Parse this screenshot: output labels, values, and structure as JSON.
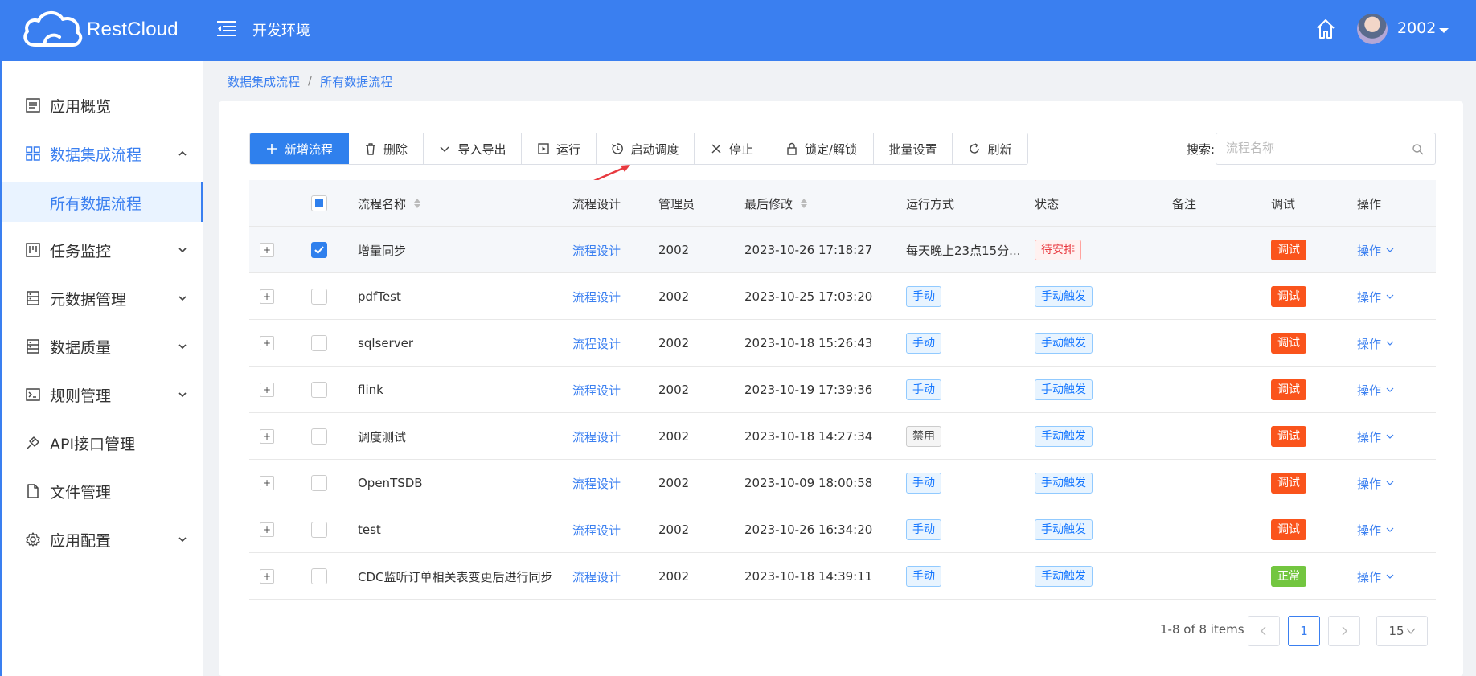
{
  "header": {
    "logo_text": "RestCloud",
    "env_title": "开发环境",
    "user_name": "2002"
  },
  "sidebar": {
    "items": [
      {
        "label": "应用概览",
        "icon": "overview-icon",
        "has_children": false
      },
      {
        "label": "数据集成流程",
        "icon": "grid-icon",
        "has_children": true,
        "expanded": true
      },
      {
        "label": "任务监控",
        "icon": "monitor-icon",
        "has_children": true
      },
      {
        "label": "元数据管理",
        "icon": "metadata-icon",
        "has_children": true
      },
      {
        "label": "数据质量",
        "icon": "quality-icon",
        "has_children": true
      },
      {
        "label": "规则管理",
        "icon": "terminal-icon",
        "has_children": true
      },
      {
        "label": "API接口管理",
        "icon": "api-icon",
        "has_children": false
      },
      {
        "label": "文件管理",
        "icon": "file-icon",
        "has_children": false
      },
      {
        "label": "应用配置",
        "icon": "gear-icon",
        "has_children": true
      }
    ],
    "sub_item": "所有数据流程"
  },
  "breadcrumb": {
    "parent": "数据集成流程",
    "separator": "/",
    "current": "所有数据流程"
  },
  "toolbar": {
    "buttons": [
      {
        "label": "新增流程",
        "icon": "plus-icon"
      },
      {
        "label": "删除",
        "icon": "trash-icon"
      },
      {
        "label": "导入导出",
        "icon": "chevron-down-icon"
      },
      {
        "label": "运行",
        "icon": "play-icon"
      },
      {
        "label": "启动调度",
        "icon": "schedule-icon"
      },
      {
        "label": "停止",
        "icon": "close-icon"
      },
      {
        "label": "锁定/解锁",
        "icon": "lock-icon"
      },
      {
        "label": "批量设置",
        "icon": ""
      },
      {
        "label": "刷新",
        "icon": "refresh-icon"
      }
    ]
  },
  "search": {
    "label": "搜索:",
    "placeholder": "流程名称",
    "value": ""
  },
  "table": {
    "columns": [
      "流程名称",
      "流程设计",
      "管理员",
      "最后修改",
      "运行方式",
      "状态",
      "备注",
      "调试",
      "操作"
    ],
    "rows": [
      {
        "name": "增量同步",
        "design": "流程设计",
        "admin": "2002",
        "modified": "2023-10-26 17:18:27",
        "run_mode": "每天晚上23点15分...",
        "run_mode_tag": "none",
        "status": "待安排",
        "status_tag": "red",
        "note": "",
        "debug": "调试",
        "debug_color": "orange",
        "op": "操作",
        "checked": true
      },
      {
        "name": "pdfTest",
        "design": "流程设计",
        "admin": "2002",
        "modified": "2023-10-25 17:03:20",
        "run_mode": "手动",
        "run_mode_tag": "blue",
        "status": "手动触发",
        "status_tag": "blue",
        "note": "",
        "debug": "调试",
        "debug_color": "orange",
        "op": "操作",
        "checked": false
      },
      {
        "name": "sqlserver",
        "design": "流程设计",
        "admin": "2002",
        "modified": "2023-10-18 15:26:43",
        "run_mode": "手动",
        "run_mode_tag": "blue",
        "status": "手动触发",
        "status_tag": "blue",
        "note": "",
        "debug": "调试",
        "debug_color": "orange",
        "op": "操作",
        "checked": false
      },
      {
        "name": "flink",
        "design": "流程设计",
        "admin": "2002",
        "modified": "2023-10-19 17:39:36",
        "run_mode": "手动",
        "run_mode_tag": "blue",
        "status": "手动触发",
        "status_tag": "blue",
        "note": "",
        "debug": "调试",
        "debug_color": "orange",
        "op": "操作",
        "checked": false
      },
      {
        "name": "调度测试",
        "design": "流程设计",
        "admin": "2002",
        "modified": "2023-10-18 14:27:34",
        "run_mode": "禁用",
        "run_mode_tag": "gray",
        "status": "手动触发",
        "status_tag": "blue",
        "note": "",
        "debug": "调试",
        "debug_color": "orange",
        "op": "操作",
        "checked": false
      },
      {
        "name": "OpenTSDB",
        "design": "流程设计",
        "admin": "2002",
        "modified": "2023-10-09 18:00:58",
        "run_mode": "手动",
        "run_mode_tag": "blue",
        "status": "手动触发",
        "status_tag": "blue",
        "note": "",
        "debug": "调试",
        "debug_color": "orange",
        "op": "操作",
        "checked": false
      },
      {
        "name": "test",
        "design": "流程设计",
        "admin": "2002",
        "modified": "2023-10-26 16:34:20",
        "run_mode": "手动",
        "run_mode_tag": "blue",
        "status": "手动触发",
        "status_tag": "blue",
        "note": "",
        "debug": "调试",
        "debug_color": "orange",
        "op": "操作",
        "checked": false
      },
      {
        "name": "CDC监听订单相关表变更后进行同步",
        "design": "流程设计",
        "admin": "2002",
        "modified": "2023-10-18 14:39:11",
        "run_mode": "手动",
        "run_mode_tag": "blue",
        "status": "手动触发",
        "status_tag": "blue",
        "note": "",
        "debug": "正常",
        "debug_color": "green",
        "op": "操作",
        "checked": false
      }
    ]
  },
  "pagination": {
    "info": "1-8 of 8 items",
    "current_page": "1",
    "page_size": "15"
  },
  "colors": {
    "primary": "#3a7ff0",
    "debug_orange": "#fa541c",
    "ok_green": "#73c640"
  }
}
